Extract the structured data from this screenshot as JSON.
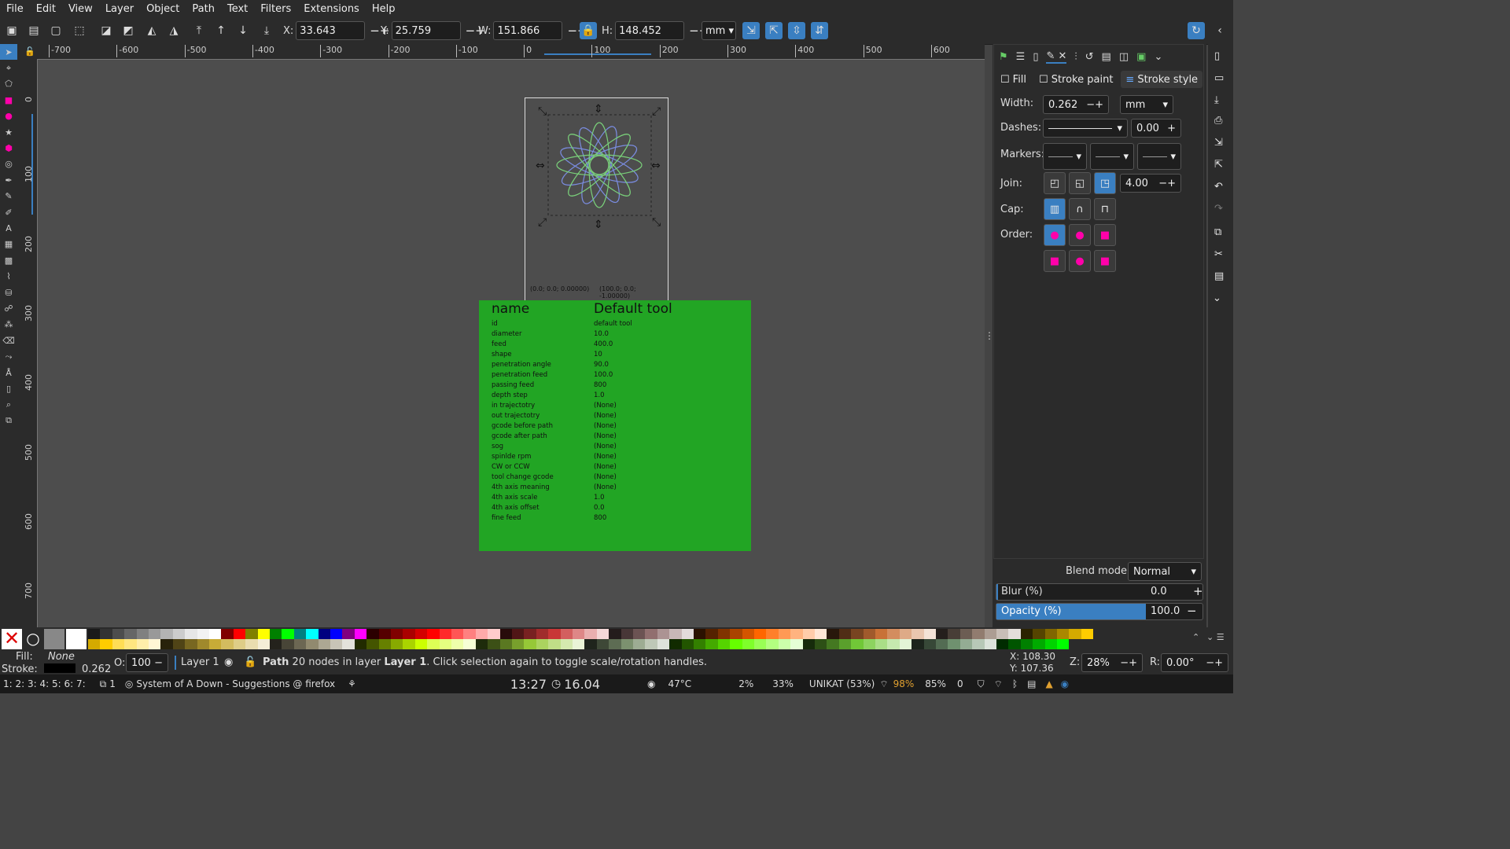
{
  "menu": [
    "File",
    "Edit",
    "View",
    "Layer",
    "Object",
    "Path",
    "Text",
    "Filters",
    "Extensions",
    "Help"
  ],
  "toolbar": {
    "x_label": "X:",
    "x": "33.643",
    "y_label": "Y:",
    "y": "25.759",
    "w_label": "W:",
    "w": "151.866",
    "h_label": "H:",
    "h": "148.452",
    "unit": "mm"
  },
  "ruler_h": [
    "-700",
    "-600",
    "-500",
    "-400",
    "-300",
    "-200",
    "-100",
    "0",
    "100",
    "200",
    "300",
    "400",
    "500",
    "600"
  ],
  "ruler_v": [
    "0",
    "100",
    "200",
    "300",
    "400",
    "500",
    "600",
    "700"
  ],
  "canvas": {
    "coord_left": "(0.0; 0.0; 0.00000)",
    "coord_right": "(100.0; 0.0; -1.00000)"
  },
  "table": {
    "header_key": "name",
    "header_value": "Default tool",
    "rows": [
      [
        "id",
        "default tool"
      ],
      [
        "diameter",
        "10.0"
      ],
      [
        "feed",
        "400.0"
      ],
      [
        "shape",
        "10"
      ],
      [
        "penetration angle",
        "90.0"
      ],
      [
        "penetration feed",
        "100.0"
      ],
      [
        "passing feed",
        "800"
      ],
      [
        "depth step",
        "1.0"
      ],
      [
        "in trajectotry",
        "(None)"
      ],
      [
        "out trajectotry",
        "(None)"
      ],
      [
        "gcode before path",
        "(None)"
      ],
      [
        "gcode after path",
        "(None)"
      ],
      [
        "sog",
        "(None)"
      ],
      [
        "spinlde rpm",
        "(None)"
      ],
      [
        "CW or CCW",
        "(None)"
      ],
      [
        "tool change gcode",
        "(None)"
      ],
      [
        "4th axis meaning",
        "(None)"
      ],
      [
        "4th axis scale",
        "1.0"
      ],
      [
        "4th axis offset",
        "0.0"
      ],
      [
        "fine feed",
        "800"
      ]
    ]
  },
  "panel": {
    "tabs": [
      "Fill",
      "Stroke paint",
      "Stroke style"
    ],
    "width_label": "Width:",
    "width": "0.262",
    "width_unit": "mm",
    "dashes_label": "Dashes:",
    "dash_offset": "0.00",
    "markers_label": "Markers:",
    "join_label": "Join:",
    "miter": "4.00",
    "cap_label": "Cap:",
    "order_label": "Order:",
    "blend_label": "Blend mode:",
    "blend": "Normal",
    "blur_label": "Blur (%)",
    "blur": "0.0",
    "opacity_label": "Opacity (%)",
    "opacity": "100.0",
    "accent": "#3a7fc1"
  },
  "status": {
    "fill_label": "Fill:",
    "fill": "None",
    "stroke_label": "Stroke:",
    "stroke_width": "0.262",
    "o_label": "O:",
    "o": "100",
    "layer": "Layer 1",
    "msg_pre": "Path",
    "msg_mid": " 20 nodes in layer ",
    "msg_layer": "Layer 1",
    "msg_post": ". Click selection again to toggle scale/rotation handles.",
    "x": "X: 108.30",
    "y": "Y: 107.36",
    "z_label": "Z:",
    "zoom": "28%",
    "r_label": "R:",
    "rot": "0.00°"
  },
  "taskbar": {
    "workspaces": "1: 2: 3: 4: 5: 6: 7:",
    "win_count": "1",
    "window_title": "System of A Down - Suggestions @ firefox",
    "clock": "13:27",
    "date": "16.04",
    "temp": "47°C",
    "cpu": "2%",
    "mem": "33%",
    "net": "UNIKAT (53%)",
    "battery": "98%",
    "vol": "85%",
    "notif": "0"
  }
}
